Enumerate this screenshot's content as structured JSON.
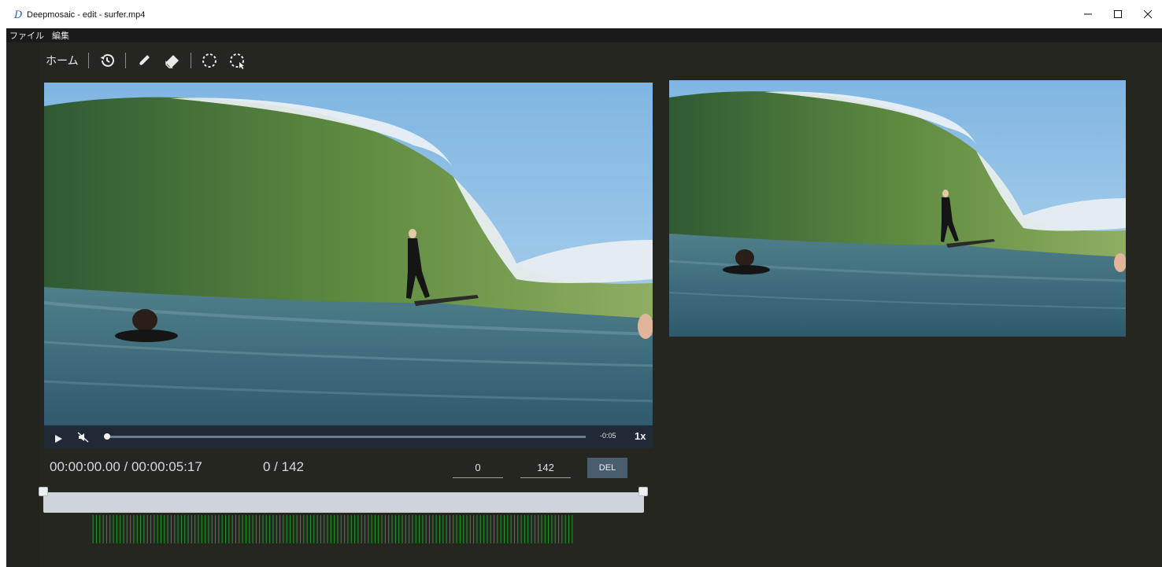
{
  "window": {
    "app_icon": "D",
    "title": "Deepmosaic - edit - surfer.mp4",
    "minimize": "—",
    "maximize": "☐",
    "close": "✕"
  },
  "menu": {
    "items": [
      "ファイル",
      "編集"
    ]
  },
  "toolbar": {
    "home_label": "ホーム",
    "icons": [
      "history-icon",
      "pen-icon",
      "eraser-icon",
      "lasso-select-icon",
      "lasso-deselect-icon"
    ]
  },
  "player": {
    "remaining": "-0:05",
    "speed": "1x",
    "progress": 0
  },
  "readout": {
    "timecode": "00:00:00.00 / 00:00:05:17",
    "frame": "0 / 142"
  },
  "range": {
    "start": "0",
    "end": "142",
    "delete_label": "DEL"
  },
  "colors": {
    "app_background": "#262621",
    "controls_background": "#1f2a36",
    "frame_marker": "#1f9a2a",
    "delete_button": "#4a5d6e"
  }
}
